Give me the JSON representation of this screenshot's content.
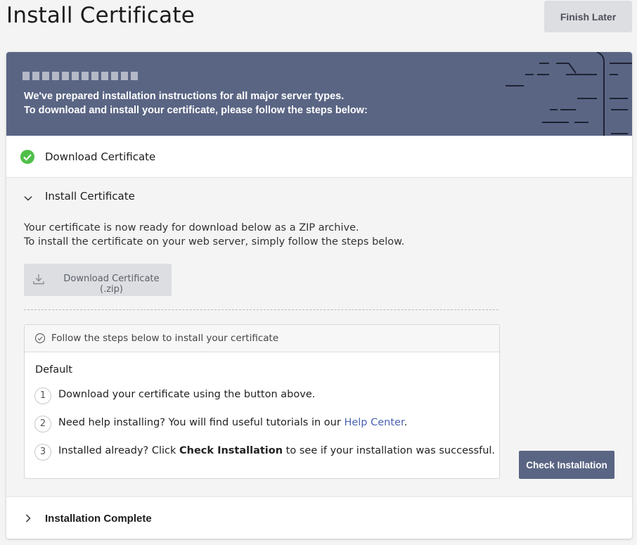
{
  "header": {
    "title": "Install Certificate",
    "finish_later_label": "Finish Later"
  },
  "banner": {
    "line1": "We've prepared installation instructions for all major server types.",
    "line2": "To download and install your certificate, please follow the steps below:"
  },
  "steps": {
    "download": {
      "label": "Download Certificate",
      "status": "completed",
      "icon": "check-circle-icon"
    },
    "install": {
      "label": "Install Certificate",
      "expanded": true,
      "text1": "Your certificate is now ready for download below as a ZIP archive.",
      "text2": "To install the certificate on your web server, simply follow the steps below.",
      "download_zip_label": "Download Certificate (.zip)",
      "instructions": {
        "header": "Follow the steps below to install your certificate",
        "server_type": "Default",
        "items": [
          {
            "num": "1",
            "text": "Download your certificate using the button above."
          },
          {
            "num": "2",
            "text_before": "Need help installing? You will find useful tutorials in our ",
            "link": "Help Center",
            "text_after": "."
          },
          {
            "num": "3",
            "text_before": "Installed already? Click ",
            "bold": "Check Installation",
            "text_after": " to see if your installation was successful."
          }
        ]
      },
      "check_installation_label": "Check Installation"
    },
    "complete": {
      "label": "Installation Complete",
      "expanded": false
    }
  },
  "colors": {
    "banner": "#5a6584",
    "success": "#4fbf4a",
    "link": "#4a63b0",
    "primary_button": "#5a6584"
  }
}
